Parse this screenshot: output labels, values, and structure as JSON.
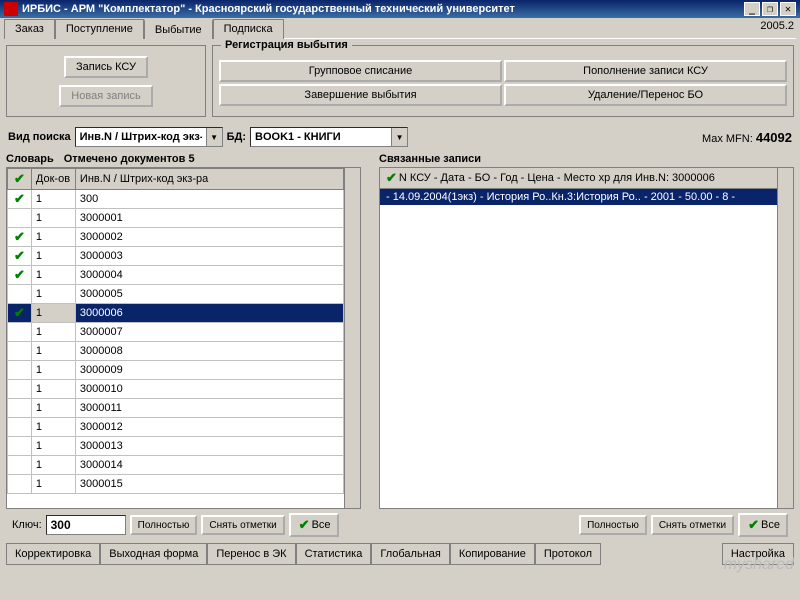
{
  "title": "ИРБИС - АРМ \"Комплектатор\" - Красноярский государственный технический университет",
  "version": "2005.2",
  "window_buttons": {
    "min": "_",
    "max": "❐",
    "close": "✕"
  },
  "tabs": [
    {
      "label": "Заказ"
    },
    {
      "label": "Поступление"
    },
    {
      "label": "Выбытие",
      "active": true
    },
    {
      "label": "Подписка"
    }
  ],
  "ksu_panel": {
    "record_btn": "Запись КСУ",
    "new_record_btn": "Новая запись"
  },
  "reg_panel": {
    "legend": "Регистрация выбытия",
    "buttons": [
      "Групповое списание",
      "Пополнение записи КСУ",
      "Завершение выбытия",
      "Удаление/Перенос БО"
    ]
  },
  "search": {
    "label": "Вид поиска",
    "value": "Инв.N / Штрих-код экз-",
    "db_label": "БД:",
    "db_value": "BOOK1 - КНИГИ",
    "mfn_label": "Max MFN:",
    "mfn_value": "44092"
  },
  "dict": {
    "title": "Словарь",
    "marked": "Отмечено документов 5",
    "cols": [
      "",
      "Док-ов",
      "Инв.N / Штрих-код экз-ра"
    ],
    "rows": [
      {
        "c": true,
        "d": "1",
        "v": "300"
      },
      {
        "c": false,
        "d": "1",
        "v": "3000001"
      },
      {
        "c": true,
        "d": "1",
        "v": "3000002"
      },
      {
        "c": true,
        "d": "1",
        "v": "3000003"
      },
      {
        "c": true,
        "d": "1",
        "v": "3000004"
      },
      {
        "c": false,
        "d": "1",
        "v": "3000005"
      },
      {
        "c": true,
        "d": "1",
        "v": "3000006",
        "sel": true
      },
      {
        "c": false,
        "d": "1",
        "v": "3000007"
      },
      {
        "c": false,
        "d": "1",
        "v": "3000008"
      },
      {
        "c": false,
        "d": "1",
        "v": "3000009"
      },
      {
        "c": false,
        "d": "1",
        "v": "3000010"
      },
      {
        "c": false,
        "d": "1",
        "v": "3000011"
      },
      {
        "c": false,
        "d": "1",
        "v": "3000012"
      },
      {
        "c": false,
        "d": "1",
        "v": "3000013"
      },
      {
        "c": false,
        "d": "1",
        "v": "3000014"
      },
      {
        "c": false,
        "d": "1",
        "v": "3000015"
      }
    ]
  },
  "linked": {
    "title": "Связанные записи",
    "header": "N КСУ - Дата - БО - Год - Цена - Место хр   для Инв.N: 3000006",
    "rows": [
      "- 14.09.2004(1экз) - История Ро..Кн.3:История Ро.. - 2001 - 50.00 - 8 -"
    ]
  },
  "key_row": {
    "label": "Ключ:",
    "value": "300",
    "full_btn": "Полностью",
    "clear_btn": "Снять отметки",
    "all_btn": "Все"
  },
  "bottom_buttons": [
    "Корректировка",
    "Выходная форма",
    "Перенос в ЭК",
    "Статистика",
    "Глобальная",
    "Копирование",
    "Протокол"
  ],
  "settings_btn": "Настройка",
  "watermark": "myshared"
}
